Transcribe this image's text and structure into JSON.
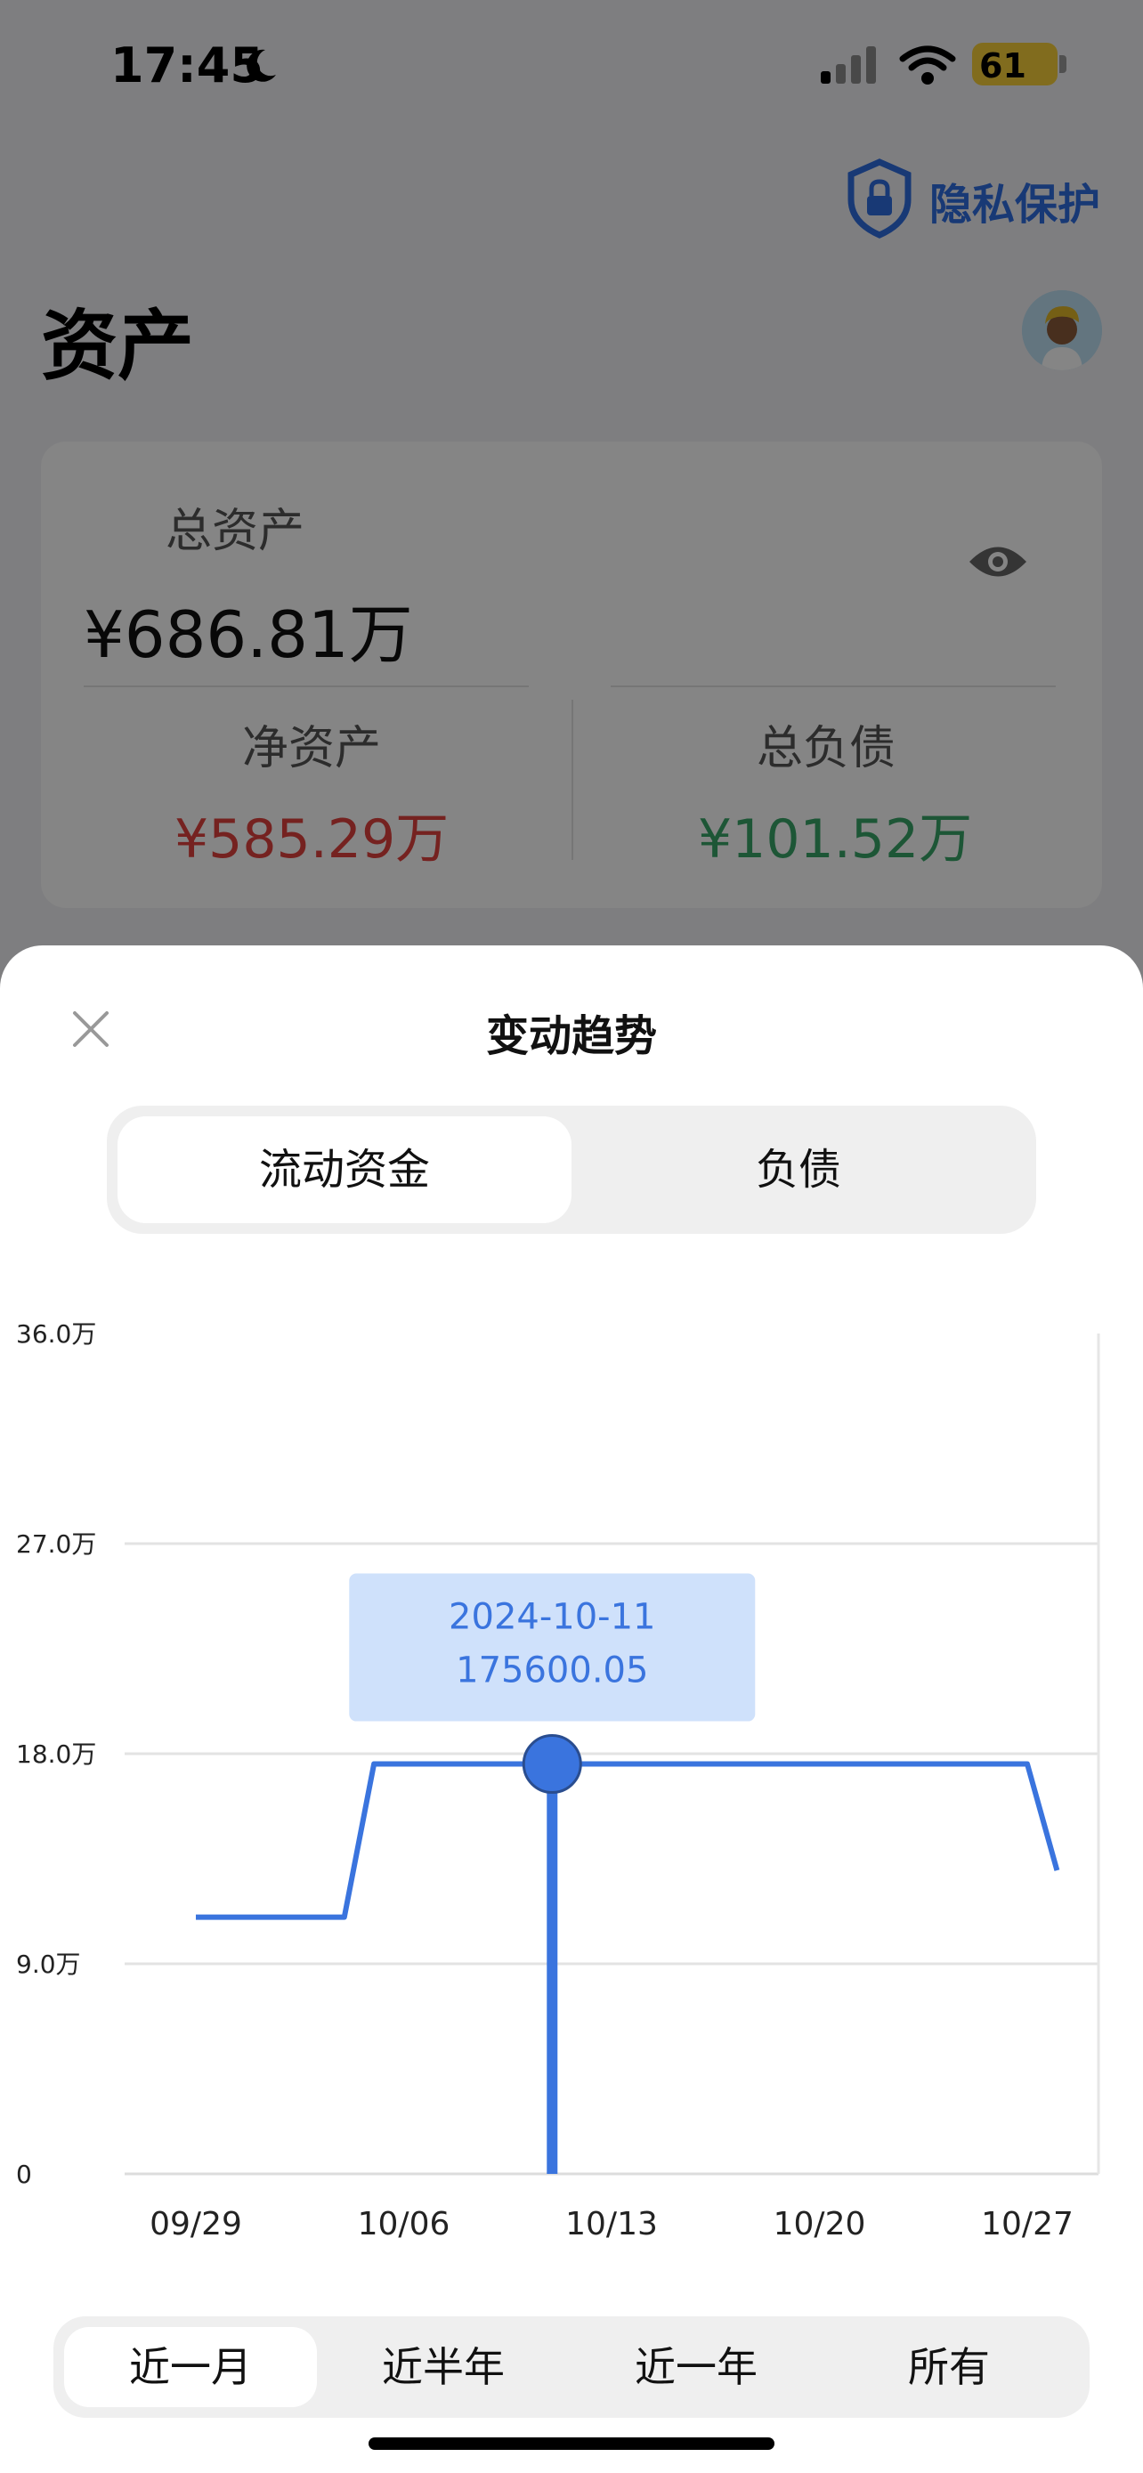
{
  "status_bar": {
    "time": "17:45",
    "battery": "61",
    "icons": [
      "moon-icon",
      "signal-icon",
      "wifi-icon",
      "battery-icon"
    ]
  },
  "header": {
    "privacy_label": "隐私保护",
    "privacy_icon": "shield-lock-icon",
    "title": "资产",
    "avatar_icon": "avatar"
  },
  "summary": {
    "total_label": "总资产",
    "total_value": "¥686.81万",
    "net_label": "净资产",
    "net_value": "¥585.29万",
    "debt_label": "总负债",
    "debt_value": "¥101.52万",
    "net_color": "#e0423e",
    "debt_color": "#38a569",
    "eye_icon": "eye-icon"
  },
  "sheet": {
    "title": "变动趋势",
    "close_icon": "close-icon",
    "tabs": [
      {
        "label": "流动资金",
        "active": true
      },
      {
        "label": "负债",
        "active": false
      }
    ],
    "ranges": [
      {
        "label": "近一月",
        "active": true
      },
      {
        "label": "近半年",
        "active": false
      },
      {
        "label": "近一年",
        "active": false
      },
      {
        "label": "所有",
        "active": false
      }
    ]
  },
  "chart_data": {
    "type": "line",
    "title": "",
    "xlabel": "",
    "ylabel": "",
    "x_tick_labels": [
      "09/29",
      "10/06",
      "10/13",
      "10/20",
      "10/27"
    ],
    "y_tick_labels": [
      "0",
      "9.0万",
      "18.0万",
      "27.0万",
      "36.0万"
    ],
    "ylim": [
      0,
      360000
    ],
    "grid": true,
    "line_color": "#3a74de",
    "tooltip": {
      "date": "2024-10-11",
      "value": "175600.05"
    },
    "series": [
      {
        "points": [
          {
            "x": "2024-09-29",
            "y": 110000
          },
          {
            "x": "2024-10-04",
            "y": 110000
          },
          {
            "x": "2024-10-05",
            "y": 175600.05
          },
          {
            "x": "2024-10-11",
            "y": 175600.05
          },
          {
            "x": "2024-10-27",
            "y": 175600.05
          },
          {
            "x": "2024-10-28",
            "y": 130000
          }
        ]
      }
    ]
  }
}
